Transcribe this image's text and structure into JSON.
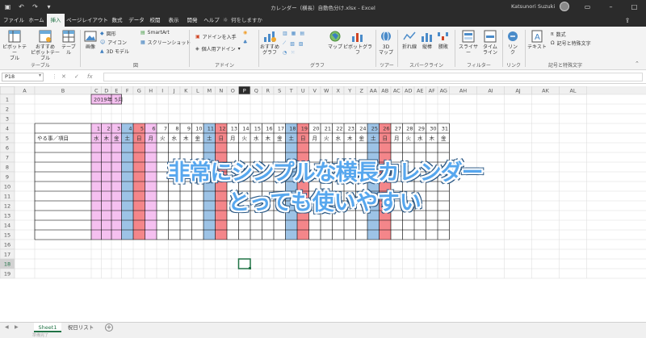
{
  "titlebar": {
    "doc_title": "カレンダー（横長）自動色分け.xlsx  -  Excel",
    "user_name": "Katsunori Suzuki",
    "qat": [
      "save-icon",
      "undo-icon",
      "redo-icon",
      "customize-icon"
    ],
    "window_buttons": [
      "ribbon-display-icon",
      "minimize-icon",
      "maximize-icon",
      "close-icon"
    ]
  },
  "menu": {
    "tabs": [
      "ファイル",
      "ホーム",
      "挿入",
      "ページレイアウト",
      "数式",
      "データ",
      "校閲",
      "表示",
      "開発",
      "ヘルプ"
    ],
    "active": "挿入",
    "tell_me": "何をしますか"
  },
  "ribbon": {
    "pivot_table": "ピボットテー\nブル",
    "recommended_pivot": "おすすめ\nピボットテーブル",
    "table": "テーブル",
    "group_tables": "テーブル",
    "images": "画像",
    "shapes": "図形",
    "icons": "アイコン",
    "models_3d": "3D モデル",
    "smartart": "SmartArt",
    "screenshot": "スクリーンショット",
    "group_illustrations": "図",
    "get_addins": "アドインを入手",
    "my_addins": "個人用アドイン",
    "group_addins": "アドイン",
    "recommended_charts": "おすすめ\nグラフ",
    "group_charts": "グラフ",
    "maps": "マップ",
    "pivot_chart": "ピボットグラフ",
    "map_3d": "3D\nマップ",
    "group_tours": "ツアー",
    "spark_line": "折れ線",
    "spark_column": "縦棒",
    "spark_winloss": "勝敗",
    "group_sparklines": "スパークライン",
    "slicer": "スライサー",
    "timeline": "タイム\nライン",
    "group_filters": "フィルター",
    "link": "リン\nク",
    "group_links": "リンク",
    "text": "テキスト",
    "equation": "数式",
    "symbol": "記号と特殊文字",
    "group_symbols": "記号と特殊文字"
  },
  "formula_bar": {
    "name_box": "P18",
    "cancel": "✕",
    "enter": "✓",
    "fx": "fx",
    "value": ""
  },
  "sheet": {
    "columns": [
      "A",
      "B",
      "C",
      "D",
      "E",
      "F",
      "G",
      "H",
      "I",
      "J",
      "K",
      "L",
      "M",
      "N",
      "O",
      "P",
      "Q",
      "R",
      "S",
      "T",
      "U",
      "V",
      "W",
      "X",
      "Y",
      "Z",
      "AA",
      "AB",
      "AC",
      "AD",
      "AE",
      "AF",
      "AG",
      "AH",
      "AI",
      "AJ",
      "AK",
      "AL"
    ],
    "selected_column": "P",
    "rows": [
      "1",
      "2",
      "3",
      "4",
      "5",
      "6",
      "7",
      "8",
      "9",
      "10",
      "11",
      "12",
      "13",
      "14",
      "15",
      "16",
      "17",
      "18",
      "19"
    ],
    "selected_row": "18",
    "year_label": "2019年",
    "month_label": "5月",
    "item_header": "やる事／項目",
    "days": [
      1,
      2,
      3,
      4,
      5,
      6,
      7,
      8,
      9,
      10,
      11,
      12,
      13,
      14,
      15,
      16,
      17,
      18,
      19,
      20,
      21,
      22,
      23,
      24,
      25,
      26,
      27,
      28,
      29,
      30,
      31
    ],
    "weekdays": [
      "水",
      "木",
      "金",
      "土",
      "日",
      "月",
      "火",
      "水",
      "木",
      "金",
      "土",
      "日",
      "月",
      "火",
      "水",
      "木",
      "金",
      "土",
      "日",
      "月",
      "火",
      "水",
      "木",
      "金",
      "土",
      "日",
      "月",
      "火",
      "水",
      "木",
      "金"
    ],
    "holiday_days": [
      1,
      2,
      3,
      6
    ],
    "colors": {
      "saturday": "#9dc3e6",
      "sunday": "#f4868a",
      "holiday": "#f5c0f0",
      "gridline": "#d9d9d9",
      "header_bg": "#f0f0f0",
      "selected_header_bg": "#2b2b2b",
      "selection_border": "#217346"
    }
  },
  "banner": {
    "line1": "非常にシンプルな横長カレンダー",
    "line2": "とっても使いやすい"
  },
  "sheet_tabs": {
    "tabs": [
      "Sheet1",
      "祝日リスト"
    ],
    "active": "Sheet1"
  },
  "status": {
    "text": "準備完了"
  }
}
